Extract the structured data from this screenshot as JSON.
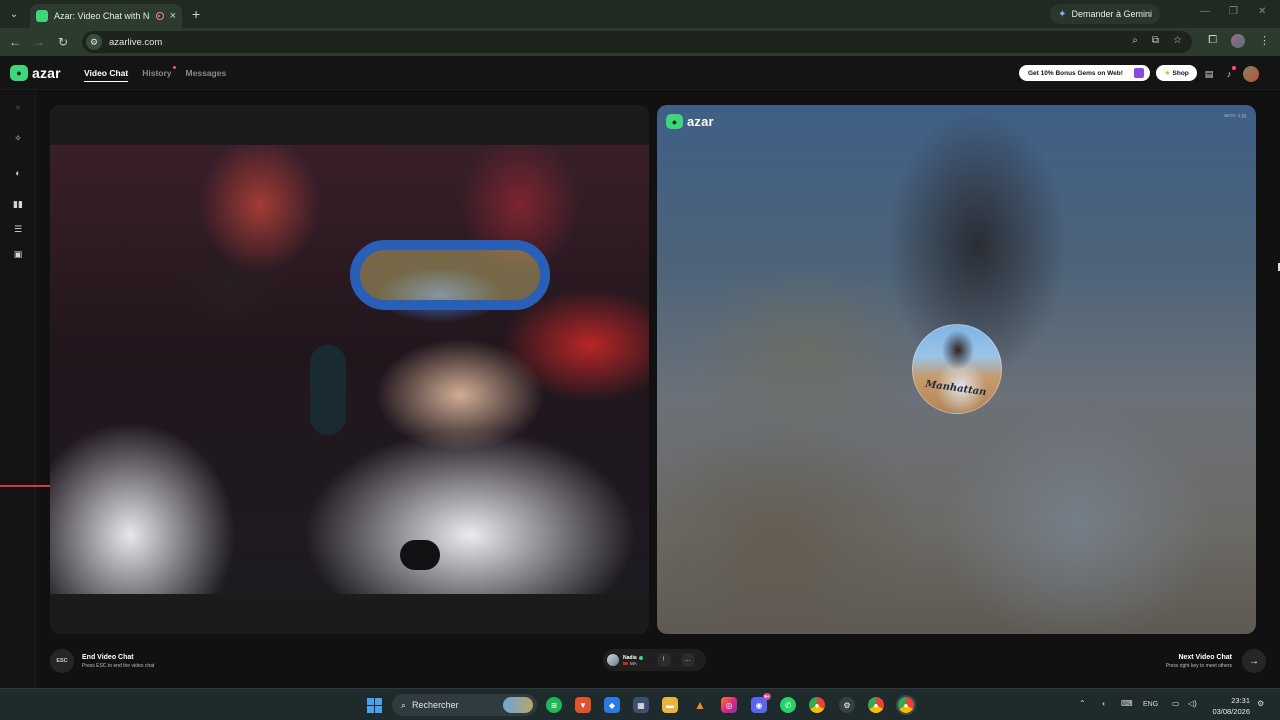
{
  "browser": {
    "tab_title": "Azar: Video Chat with New",
    "tab_close": "×",
    "new_tab": "+",
    "gemini_label": "Demander à Gemini",
    "url": "azarlive.com"
  },
  "app": {
    "logo_text": "azar",
    "nav": {
      "video_chat": "Video Chat",
      "history": "History",
      "messages": "Messages"
    },
    "promo_label": "Get 10% Bonus Gems on Web!",
    "shop_label": "Shop"
  },
  "peer": {
    "logo_text": "azar",
    "id_text": "WKTH-1jQ",
    "avatar_caption": "Manhattan",
    "name": "Nadia",
    "country_code": "MA"
  },
  "controls": {
    "esc_label": "ESC",
    "end_title": "End Video Chat",
    "end_sub": "Press ESC to end the video chat",
    "next_title": "Next Video Chat",
    "next_sub": "Press right key to meet others",
    "next_arrow": "→"
  },
  "taskbar": {
    "search_label": "Rechercher",
    "discord_badge": "9+",
    "lang": "ENG",
    "time": "23:31",
    "date": "03/08/2026"
  },
  "colors": {
    "brand": "#3fd57c",
    "chrome_green": "#2d3a2e",
    "notify": "#ff4d6a"
  }
}
